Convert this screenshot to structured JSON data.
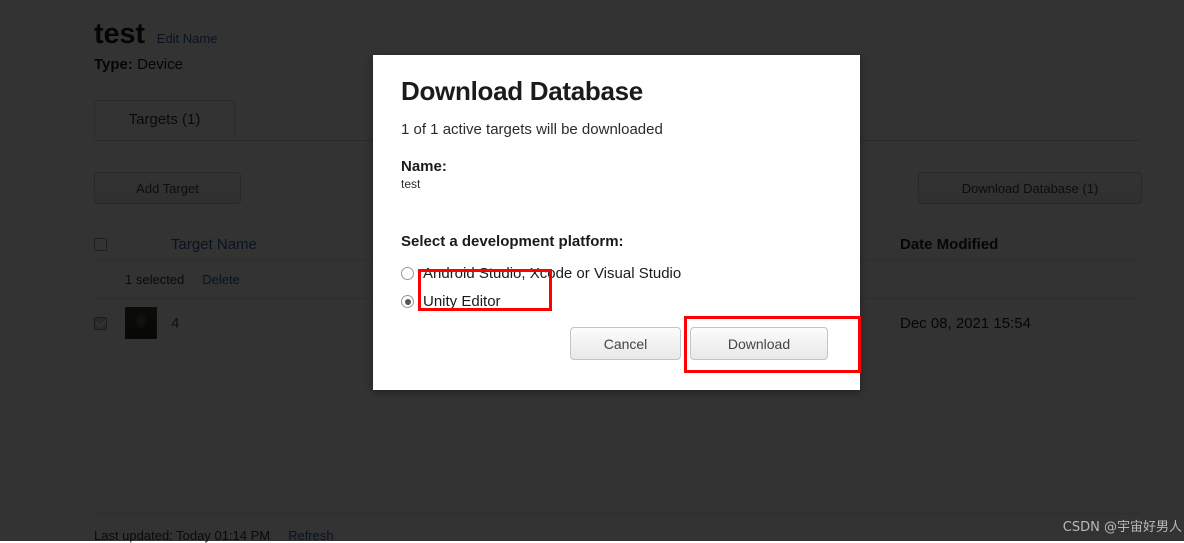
{
  "page": {
    "title": "test",
    "edit_name_link": "Edit Name",
    "type_label": "Type:",
    "type_value": "Device",
    "tab_targets": "Targets (1)",
    "add_target_button": "Add Target",
    "download_database_button": "Download Database (1)"
  },
  "table": {
    "header_name": "Target Name",
    "header_date": "Date Modified",
    "selection_count": "1 selected",
    "delete_link": "Delete",
    "rows": [
      {
        "name": "4",
        "date_modified": "Dec 08, 2021 15:54"
      }
    ]
  },
  "footer": {
    "last_updated": "Last updated: Today 01:14 PM",
    "refresh_link": "Refresh"
  },
  "modal": {
    "title": "Download Database",
    "subtitle": "1 of 1 active targets will be downloaded",
    "name_label": "Name:",
    "name_value": "test",
    "platform_label": "Select a development platform:",
    "options": [
      {
        "label": "Android Studio, Xcode or Visual Studio",
        "selected": false
      },
      {
        "label": "Unity Editor",
        "selected": true
      }
    ],
    "cancel_button": "Cancel",
    "download_button": "Download"
  },
  "watermark": {
    "text": "CSDN @宇宙好男人"
  },
  "colors": {
    "link": "#2c5f9e",
    "annotation": "#ff0000",
    "overlay": "rgba(0,0,0,0.80)"
  }
}
